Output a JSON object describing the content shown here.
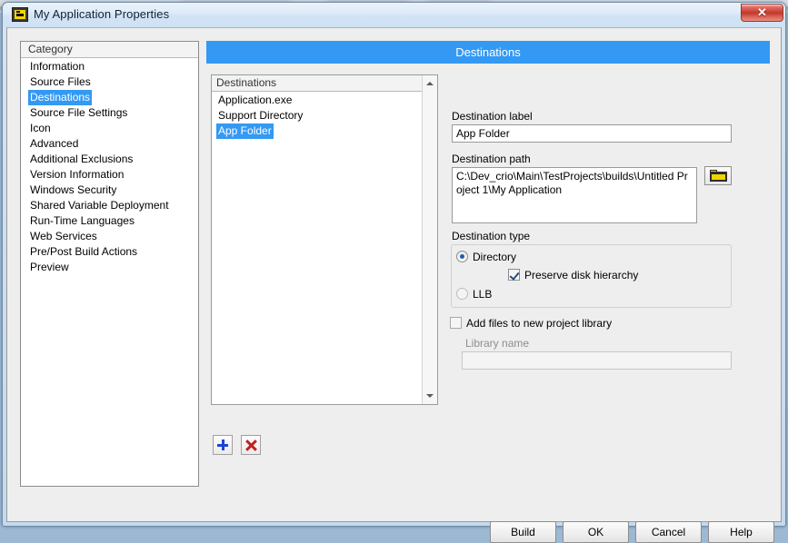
{
  "window": {
    "title": "My Application Properties",
    "icon": "labview-vi-icon",
    "close_label": "✕"
  },
  "category_panel": {
    "header": "Category",
    "items": [
      {
        "label": "Information",
        "selected": false
      },
      {
        "label": "Source Files",
        "selected": false
      },
      {
        "label": "Destinations",
        "selected": true
      },
      {
        "label": "Source File Settings",
        "selected": false
      },
      {
        "label": "Icon",
        "selected": false
      },
      {
        "label": "Advanced",
        "selected": false
      },
      {
        "label": "Additional Exclusions",
        "selected": false
      },
      {
        "label": "Version Information",
        "selected": false
      },
      {
        "label": "Windows Security",
        "selected": false
      },
      {
        "label": "Shared Variable Deployment",
        "selected": false
      },
      {
        "label": "Run-Time Languages",
        "selected": false
      },
      {
        "label": "Web Services",
        "selected": false
      },
      {
        "label": "Pre/Post Build Actions",
        "selected": false
      },
      {
        "label": "Preview",
        "selected": false
      }
    ]
  },
  "panel": {
    "banner_title": "Destinations",
    "banner_color": "#3399f3"
  },
  "destinations_list": {
    "header": "Destinations",
    "items": [
      {
        "label": "Application.exe",
        "selected": false
      },
      {
        "label": "Support Directory",
        "selected": false
      },
      {
        "label": "App Folder",
        "selected": true
      }
    ],
    "tools": {
      "add_label": "+",
      "remove_label": "✕"
    },
    "scrollbar": {
      "up_arrow": "scroll-up-icon",
      "down_arrow": "scroll-down-icon"
    }
  },
  "form": {
    "destination_label": {
      "label": "Destination label",
      "value": "App Folder"
    },
    "destination_path": {
      "label": "Destination path",
      "value": "C:\\Dev_crio\\Main\\TestProjects\\builds\\Untitled Project 1\\My Application",
      "browse_icon": "folder-icon"
    },
    "destination_type": {
      "label": "Destination type",
      "options": [
        {
          "label": "Directory",
          "selected": true
        },
        {
          "label": "LLB",
          "selected": false
        }
      ],
      "preserve_disk_hierarchy": {
        "label": "Preserve disk hierarchy",
        "checked": true
      }
    },
    "project_library": {
      "add_files_label": "Add files to new project library",
      "add_files_checked": false,
      "library_name_label": "Library name",
      "library_name_value": "",
      "library_name_placeholder": "",
      "disabled": true
    }
  },
  "buttons": {
    "build": "Build",
    "ok": "OK",
    "cancel": "Cancel",
    "help": "Help"
  }
}
